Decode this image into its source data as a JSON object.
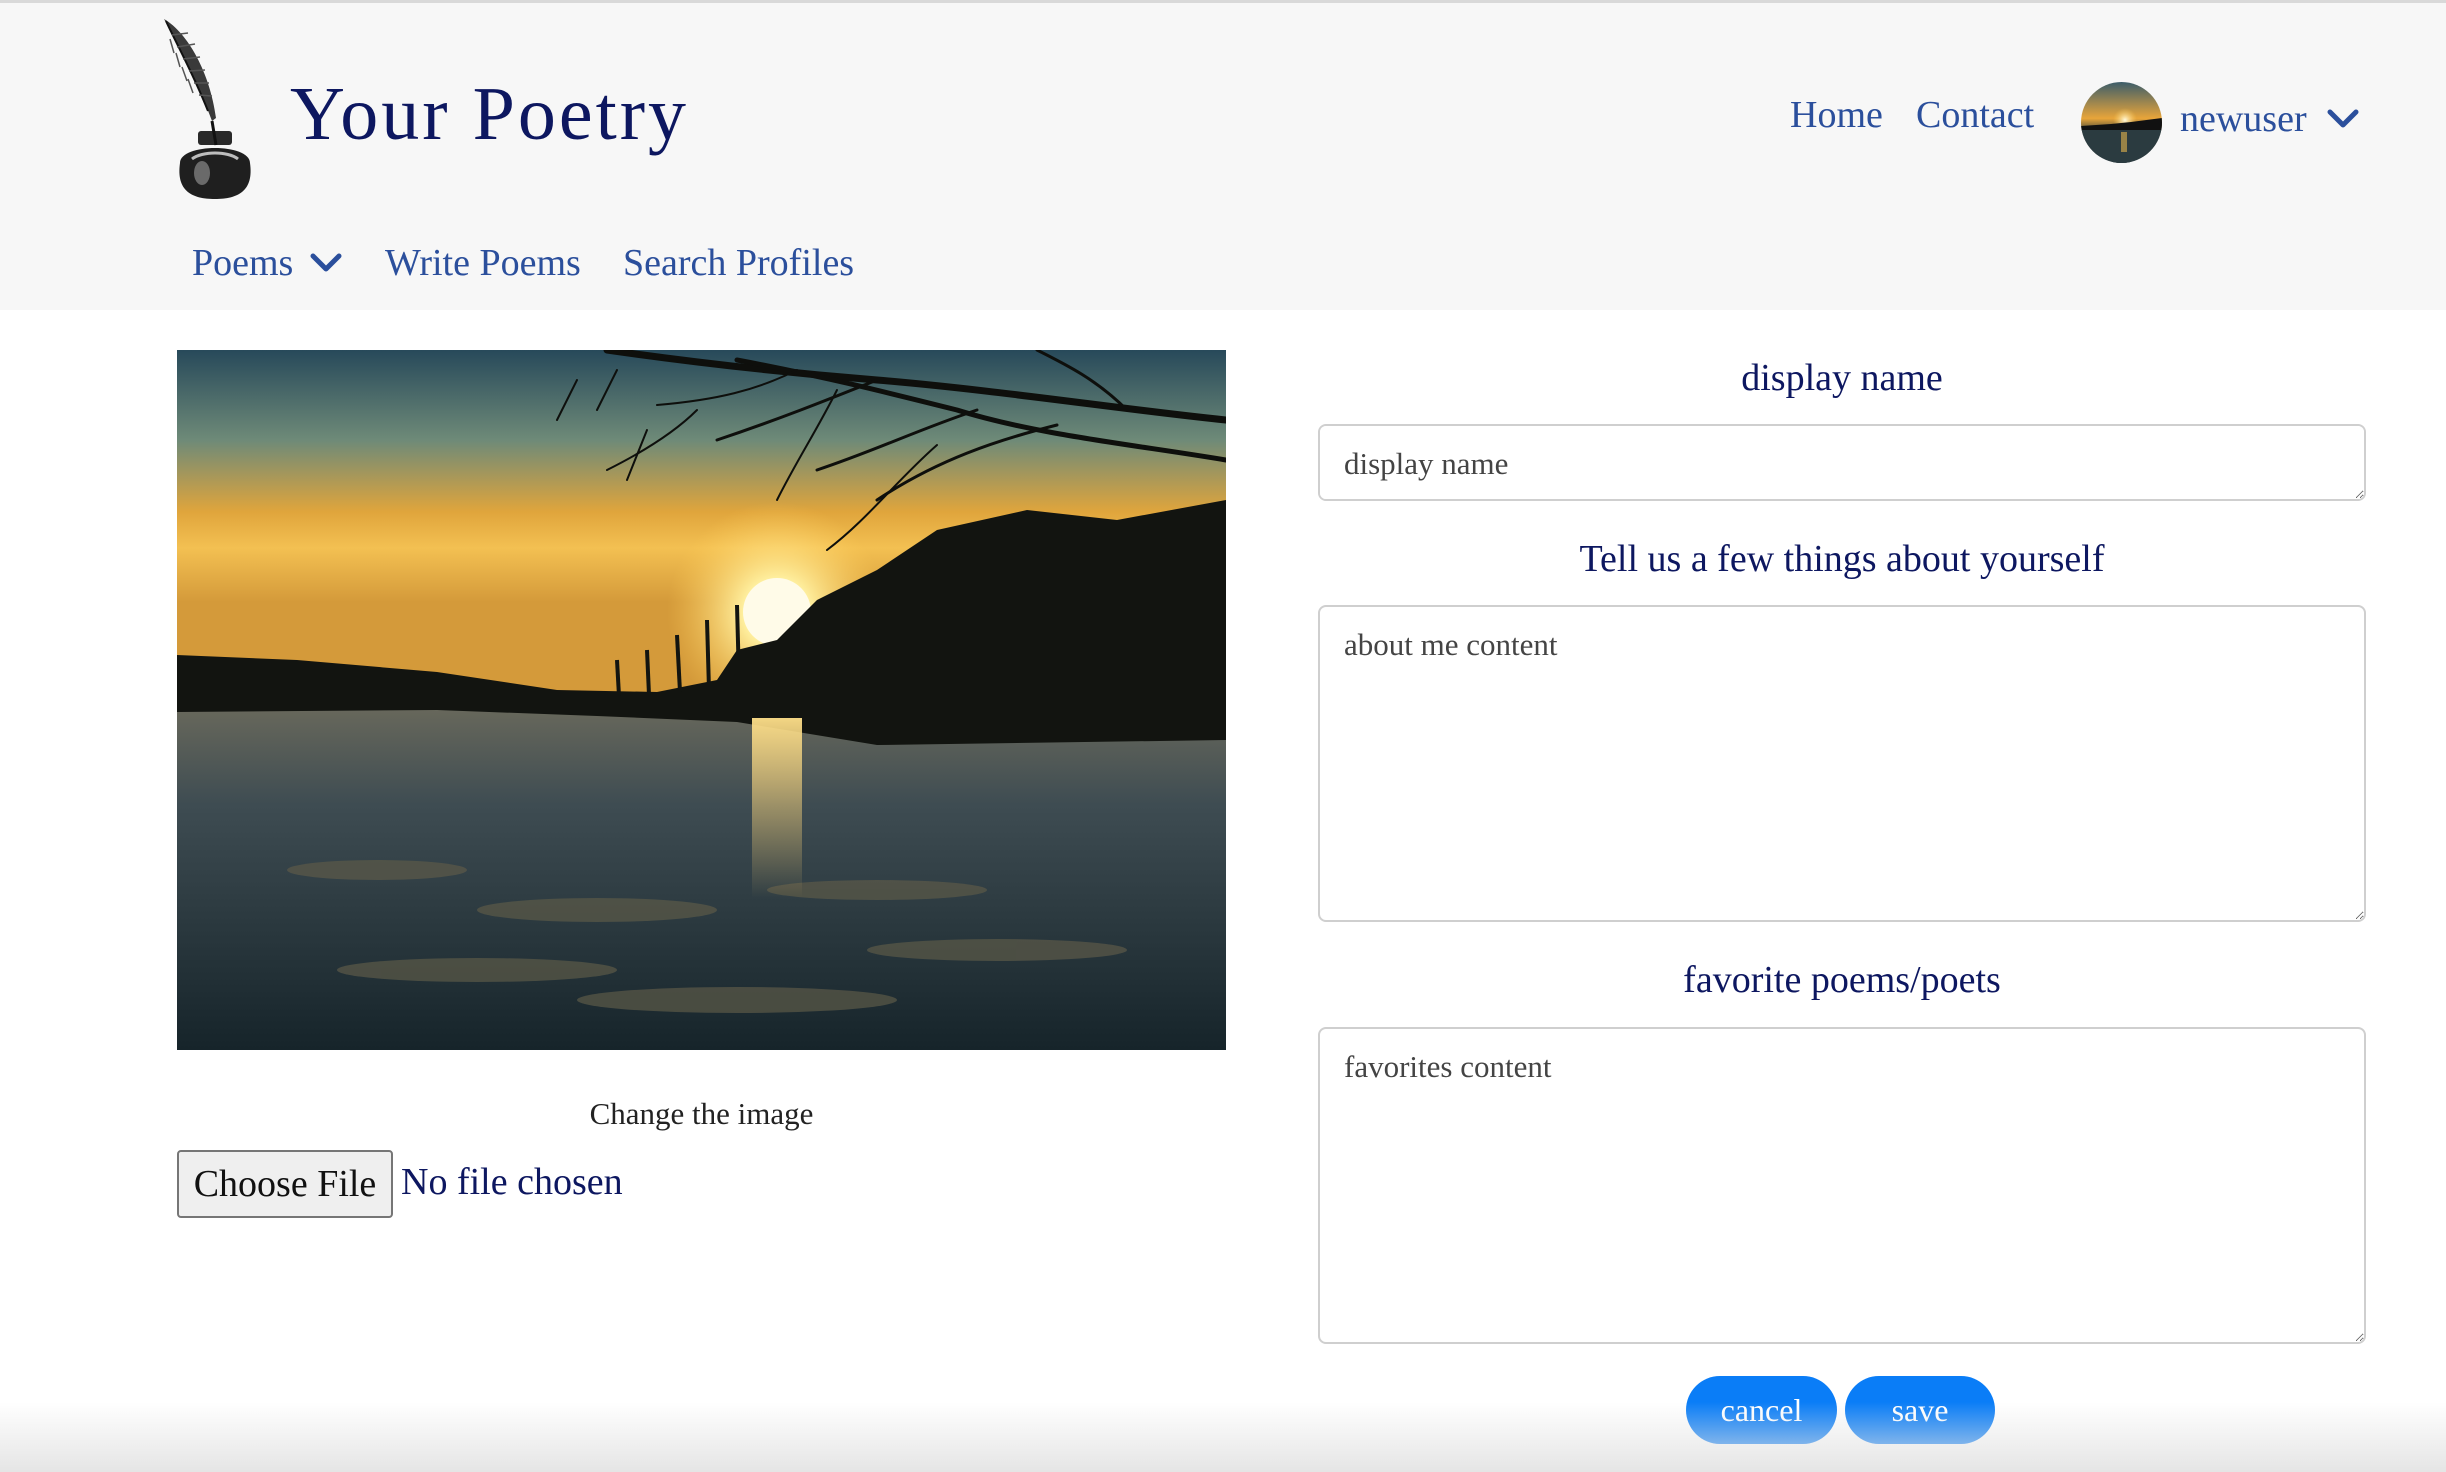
{
  "header": {
    "brand_title": "Your Poetry",
    "logo_icon": "quill-inkwell-icon",
    "nav_top": {
      "home": "Home",
      "contact": "Contact"
    },
    "user": {
      "name": "newuser",
      "avatar_icon": "sunset-avatar-icon"
    },
    "nav_main": {
      "poems": "Poems",
      "write_poems": "Write Poems",
      "search_profiles": "Search Profiles"
    }
  },
  "profile_image": {
    "caption": "Change the image",
    "file_button": "Choose File",
    "file_status": "No file chosen"
  },
  "form": {
    "display_name": {
      "label": "display name",
      "placeholder": "display name"
    },
    "about": {
      "label": "Tell us a few things about yourself",
      "placeholder": "about me content"
    },
    "favorites": {
      "label": "favorite poems/poets",
      "placeholder": "favorites content"
    },
    "cancel_label": "cancel",
    "save_label": "save"
  },
  "colors": {
    "header_bg": "#f7f7f7",
    "brand_text": "#0d1760",
    "link": "#2b4f9c",
    "button_primary": "#0a7df7"
  }
}
